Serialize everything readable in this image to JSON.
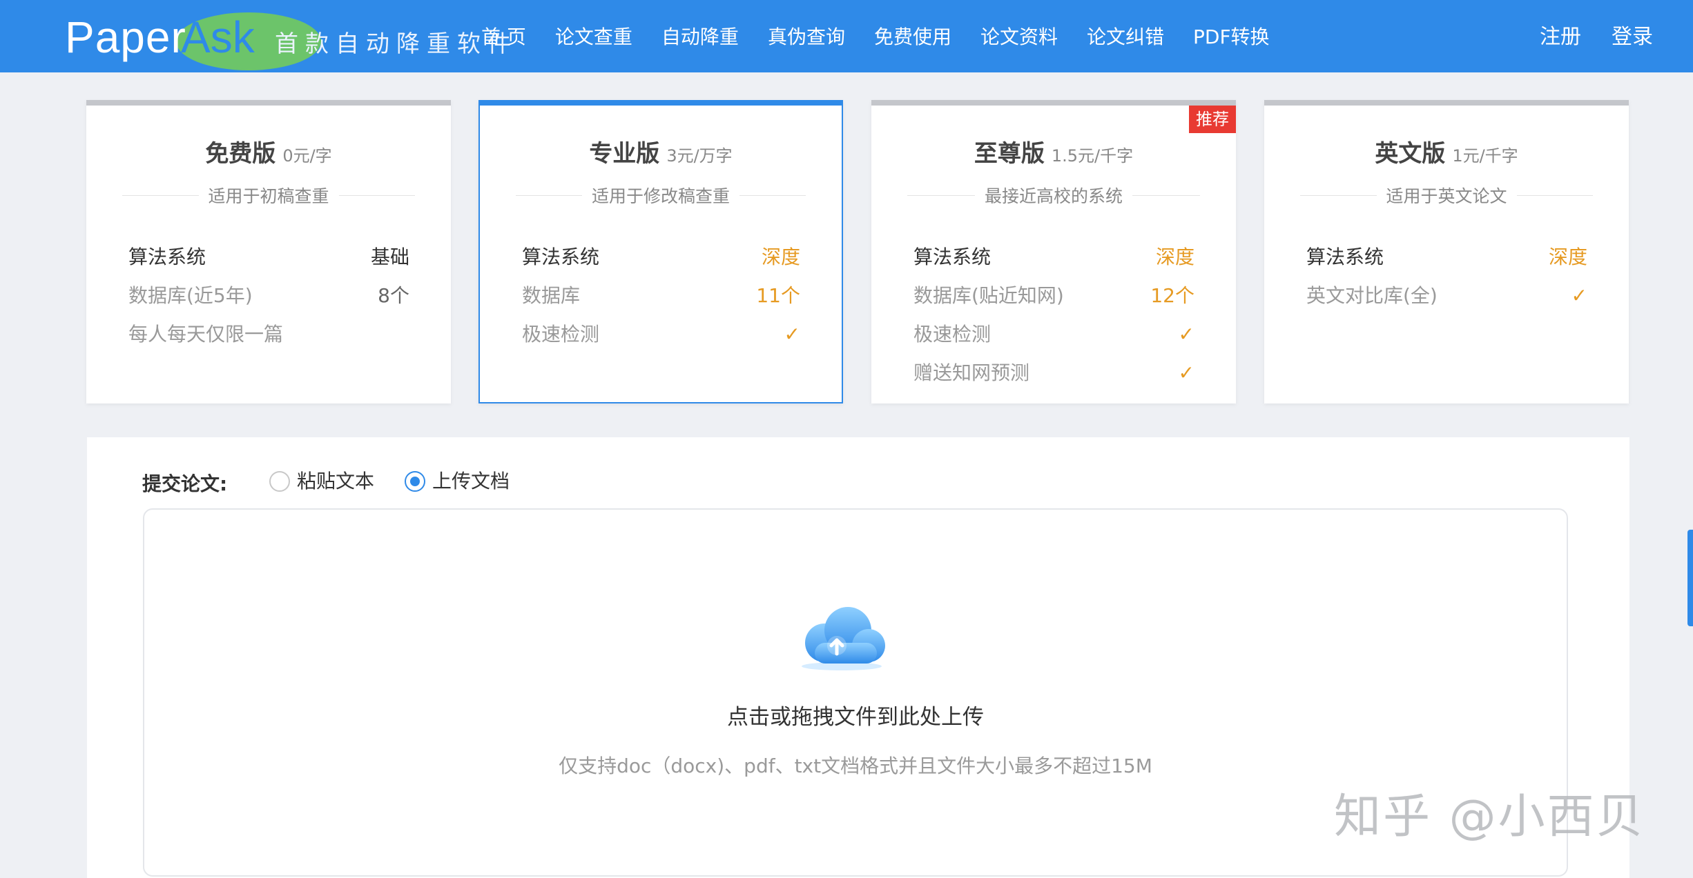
{
  "header": {
    "logo_paper": "Paper",
    "logo_ask": "Ask",
    "slogan": "首款自动降重软件",
    "nav": [
      "首 页",
      "论文查重",
      "自动降重",
      "真伪查询",
      "免费使用",
      "论文资料",
      "论文纠错",
      "PDF转换"
    ],
    "register": "注册",
    "login": "登录"
  },
  "plans": [
    {
      "name": "免费版",
      "price": "0元/字",
      "desc": "适用于初稿查重",
      "rows": [
        {
          "k": "算法系统",
          "v": "基础"
        },
        {
          "k": "数据库(近5年)",
          "v": "8个"
        },
        {
          "k": "每人每天仅限一篇",
          "v": ""
        }
      ]
    },
    {
      "name": "专业版",
      "price": "3元/万字",
      "desc": "适用于修改稿查重",
      "rows": [
        {
          "k": "算法系统",
          "v": "深度"
        },
        {
          "k": "数据库",
          "v": "11个"
        },
        {
          "k": "极速检测",
          "v": "✓"
        }
      ]
    },
    {
      "name": "至尊版",
      "price": "1.5元/千字",
      "desc": "最接近高校的系统",
      "tag": "推荐",
      "rows": [
        {
          "k": "算法系统",
          "v": "深度"
        },
        {
          "k": "数据库(贴近知网)",
          "v": "12个"
        },
        {
          "k": "极速检测",
          "v": "✓"
        },
        {
          "k": "赠送知网预测",
          "v": "✓"
        }
      ]
    },
    {
      "name": "英文版",
      "price": "1元/千字",
      "desc": "适用于英文论文",
      "rows": [
        {
          "k": "算法系统",
          "v": "深度"
        },
        {
          "k": "英文对比库(全)",
          "v": "✓"
        }
      ]
    }
  ],
  "submit": {
    "label": "提交论文:",
    "option_paste": "粘贴文本",
    "option_upload": "上传文档",
    "selected": "上传文档",
    "upload_icon": "cloud-upload-icon",
    "drop_title": "点击或拖拽文件到此处上传",
    "drop_hint": "仅支持doc（docx)、pdf、txt文档格式并且文件大小最多不超过15M"
  },
  "watermark": "知乎 @小西贝",
  "colors": {
    "primary": "#2f8ae8",
    "accent": "#e69a22",
    "tag": "#e83a32",
    "logo_green": "#6cc46a"
  }
}
